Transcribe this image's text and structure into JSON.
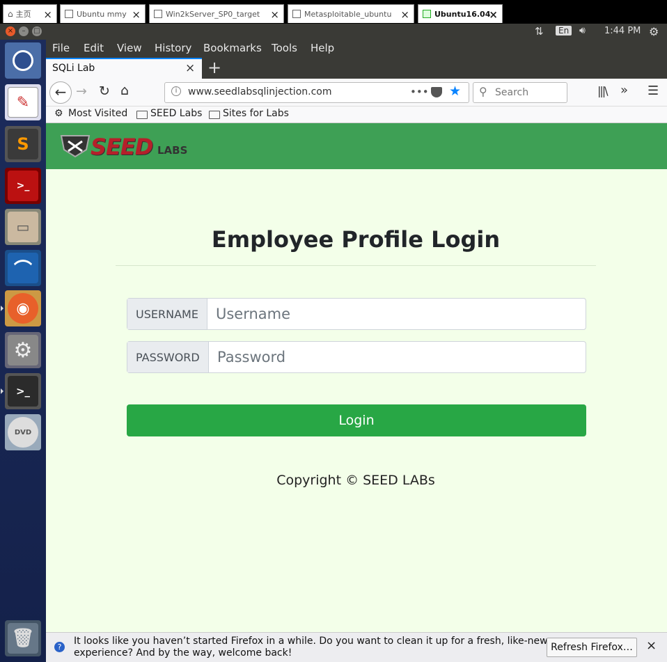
{
  "vm_tabs": [
    {
      "label": "主页",
      "icon": "home-icon"
    },
    {
      "label": "Ubuntu mmy",
      "icon": "vm-icon"
    },
    {
      "label": "Win2kServer_SP0_target",
      "icon": "vm-icon"
    },
    {
      "label": "Metasploitable_ubuntu",
      "icon": "vm-icon"
    },
    {
      "label": "Ubuntu16.04",
      "icon": "vm-running-icon"
    }
  ],
  "panel": {
    "keyboard": "En",
    "time": "1:44 PM"
  },
  "launcher": [
    "ubuntu-dash-icon",
    "text-editor-icon",
    "sublime-text-icon",
    "terminator-icon",
    "file-archiver-icon",
    "wireshark-icon",
    "firefox-icon",
    "system-settings-icon",
    "terminal-icon",
    "dvd-icon",
    "trash-icon"
  ],
  "menu": {
    "file": "File",
    "edit": "Edit",
    "view": "View",
    "history": "History",
    "bookmarks": "Bookmarks",
    "tools": "Tools",
    "help": "Help"
  },
  "tab": {
    "title": "SQLi Lab"
  },
  "nav": {
    "url": "www.seedlabsqlinjection.com",
    "search_placeholder": "Search"
  },
  "bookmarks": {
    "most_visited": "Most Visited",
    "seed_labs": "SEED Labs",
    "sites_for_labs": "Sites for Labs"
  },
  "page": {
    "logo_seed": "SEED",
    "logo_labs": "LABS",
    "title": "Employee Profile Login",
    "username_label": "USERNAME",
    "username_placeholder": "Username",
    "password_label": "PASSWORD",
    "password_placeholder": "Password",
    "login_button": "Login",
    "copyright": "Copyright © SEED LABs"
  },
  "notification": {
    "line1": "It looks like you haven’t started Firefox in a while. Do you want to clean it up for a fresh, like-new",
    "line2": "experience? And by the way, welcome back!",
    "button": "Refresh Firefox…"
  }
}
